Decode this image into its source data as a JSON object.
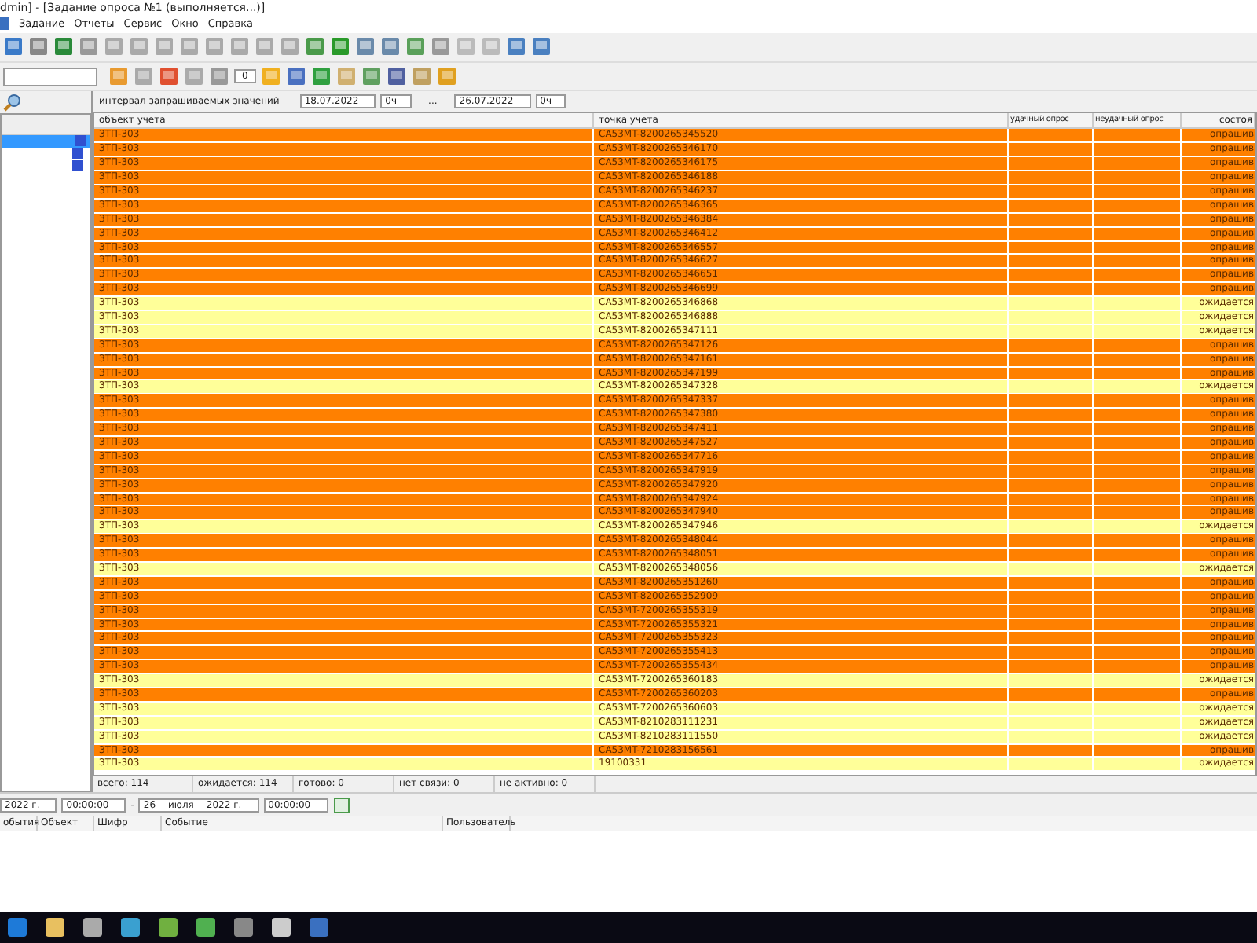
{
  "window": {
    "title": "dmin] - [Задание опроса  №1 (выполняется...)]"
  },
  "menu": [
    "Задание",
    "Отчеты",
    "Сервис",
    "Окно",
    "Справка"
  ],
  "toolbar2": {
    "counter": "0"
  },
  "filter": {
    "label": "интервал запрашиваемых значений",
    "from_date": "18.07.2022",
    "from_hour": "0ч",
    "separator": "...",
    "to_date": "26.07.2022",
    "to_hour": "0ч"
  },
  "table": {
    "columns": [
      "объект учета",
      "точка учета",
      "удачный опрос",
      "неудачный опрос",
      "состоя"
    ],
    "rows": [
      {
        "object": "ЗТП-303",
        "point": "CA53MT-8200265345520",
        "status": "опрашив",
        "kind": "polling"
      },
      {
        "object": "ЗТП-303",
        "point": "CA53MT-8200265346170",
        "status": "опрашив",
        "kind": "polling"
      },
      {
        "object": "ЗТП-303",
        "point": "CA53MT-8200265346175",
        "status": "опрашив",
        "kind": "polling"
      },
      {
        "object": "ЗТП-303",
        "point": "CA53MT-8200265346188",
        "status": "опрашив",
        "kind": "polling"
      },
      {
        "object": "ЗТП-303",
        "point": "CA53MT-8200265346237",
        "status": "опрашив",
        "kind": "polling"
      },
      {
        "object": "ЗТП-303",
        "point": "CA53MT-8200265346365",
        "status": "опрашив",
        "kind": "polling"
      },
      {
        "object": "ЗТП-303",
        "point": "CA53MT-8200265346384",
        "status": "опрашив",
        "kind": "polling"
      },
      {
        "object": "ЗТП-303",
        "point": "CA53MT-8200265346412",
        "status": "опрашив",
        "kind": "polling"
      },
      {
        "object": "ЗТП-303",
        "point": "CA53MT-8200265346557",
        "status": "опрашив",
        "kind": "polling"
      },
      {
        "object": "ЗТП-303",
        "point": "CA53MT-8200265346627",
        "status": "опрашив",
        "kind": "polling"
      },
      {
        "object": "ЗТП-303",
        "point": "CA53MT-8200265346651",
        "status": "опрашив",
        "kind": "polling"
      },
      {
        "object": "ЗТП-303",
        "point": "CA53MT-8200265346699",
        "status": "опрашив",
        "kind": "polling"
      },
      {
        "object": "ЗТП-303",
        "point": "CA53MT-8200265346868",
        "status": "ожидается",
        "kind": "waiting"
      },
      {
        "object": "ЗТП-303",
        "point": "CA53MT-8200265346888",
        "status": "ожидается",
        "kind": "waiting"
      },
      {
        "object": "ЗТП-303",
        "point": "CA53MT-8200265347111",
        "status": "ожидается",
        "kind": "waiting"
      },
      {
        "object": "ЗТП-303",
        "point": "CA53MT-8200265347126",
        "status": "опрашив",
        "kind": "polling"
      },
      {
        "object": "ЗТП-303",
        "point": "CA53MT-8200265347161",
        "status": "опрашив",
        "kind": "polling"
      },
      {
        "object": "ЗТП-303",
        "point": "CA53MT-8200265347199",
        "status": "опрашив",
        "kind": "polling"
      },
      {
        "object": "ЗТП-303",
        "point": "CA53MT-8200265347328",
        "status": "ожидается",
        "kind": "waiting"
      },
      {
        "object": "ЗТП-303",
        "point": "CA53MT-8200265347337",
        "status": "опрашив",
        "kind": "polling"
      },
      {
        "object": "ЗТП-303",
        "point": "CA53MT-8200265347380",
        "status": "опрашив",
        "kind": "polling"
      },
      {
        "object": "ЗТП-303",
        "point": "CA53MT-8200265347411",
        "status": "опрашив",
        "kind": "polling"
      },
      {
        "object": "ЗТП-303",
        "point": "CA53MT-8200265347527",
        "status": "опрашив",
        "kind": "polling"
      },
      {
        "object": "ЗТП-303",
        "point": "CA53MT-8200265347716",
        "status": "опрашив",
        "kind": "polling"
      },
      {
        "object": "ЗТП-303",
        "point": "CA53MT-8200265347919",
        "status": "опрашив",
        "kind": "polling"
      },
      {
        "object": "ЗТП-303",
        "point": "CA53MT-8200265347920",
        "status": "опрашив",
        "kind": "polling"
      },
      {
        "object": "ЗТП-303",
        "point": "CA53MT-8200265347924",
        "status": "опрашив",
        "kind": "polling"
      },
      {
        "object": "ЗТП-303",
        "point": "CA53MT-8200265347940",
        "status": "опрашив",
        "kind": "polling"
      },
      {
        "object": "ЗТП-303",
        "point": "CA53MT-8200265347946",
        "status": "ожидается",
        "kind": "waiting"
      },
      {
        "object": "ЗТП-303",
        "point": "CA53MT-8200265348044",
        "status": "опрашив",
        "kind": "polling"
      },
      {
        "object": "ЗТП-303",
        "point": "CA53MT-8200265348051",
        "status": "опрашив",
        "kind": "polling"
      },
      {
        "object": "ЗТП-303",
        "point": "CA53MT-8200265348056",
        "status": "ожидается",
        "kind": "waiting"
      },
      {
        "object": "ЗТП-303",
        "point": "CA53MT-8200265351260",
        "status": "опрашив",
        "kind": "polling"
      },
      {
        "object": "ЗТП-303",
        "point": "CA53MT-8200265352909",
        "status": "опрашив",
        "kind": "polling"
      },
      {
        "object": "ЗТП-303",
        "point": "CA53MT-7200265355319",
        "status": "опрашив",
        "kind": "polling"
      },
      {
        "object": "ЗТП-303",
        "point": "CA53MT-7200265355321",
        "status": "опрашив",
        "kind": "polling"
      },
      {
        "object": "ЗТП-303",
        "point": "CA53MT-7200265355323",
        "status": "опрашив",
        "kind": "polling"
      },
      {
        "object": "ЗТП-303",
        "point": "CA53MT-7200265355413",
        "status": "опрашив",
        "kind": "polling"
      },
      {
        "object": "ЗТП-303",
        "point": "CA53MT-7200265355434",
        "status": "опрашив",
        "kind": "polling"
      },
      {
        "object": "ЗТП-303",
        "point": "CA53MT-7200265360183",
        "status": "ожидается",
        "kind": "waiting"
      },
      {
        "object": "ЗТП-303",
        "point": "CA53MT-7200265360203",
        "status": "опрашив",
        "kind": "polling"
      },
      {
        "object": "ЗТП-303",
        "point": "CA53MT-7200265360603",
        "status": "ожидается",
        "kind": "waiting"
      },
      {
        "object": "ЗТП-303",
        "point": "CA53MT-8210283111231",
        "status": "ожидается",
        "kind": "waiting"
      },
      {
        "object": "ЗТП-303",
        "point": "CA53MT-8210283111550",
        "status": "ожидается",
        "kind": "waiting"
      },
      {
        "object": "ЗТП-303",
        "point": "CA53MT-7210283156561",
        "status": "опрашив",
        "kind": "polling"
      },
      {
        "object": "ЗТП-303",
        "point": "19100331",
        "status": "ожидается",
        "kind": "waiting"
      }
    ]
  },
  "status_bar": [
    "всего: 114",
    "ожидается: 114",
    "готово: 0",
    "нет связи: 0",
    "не активно: 0"
  ],
  "date_range": {
    "from_year": "2022 г.",
    "from_time": "00:00:00",
    "dash": "-",
    "to_day": "26",
    "to_month": "июля",
    "to_year": "2022 г.",
    "to_time": "00:00:00"
  },
  "events": {
    "columns": [
      "обытия",
      "Объект",
      "Шифр",
      "Событие",
      "Пользователь"
    ]
  }
}
